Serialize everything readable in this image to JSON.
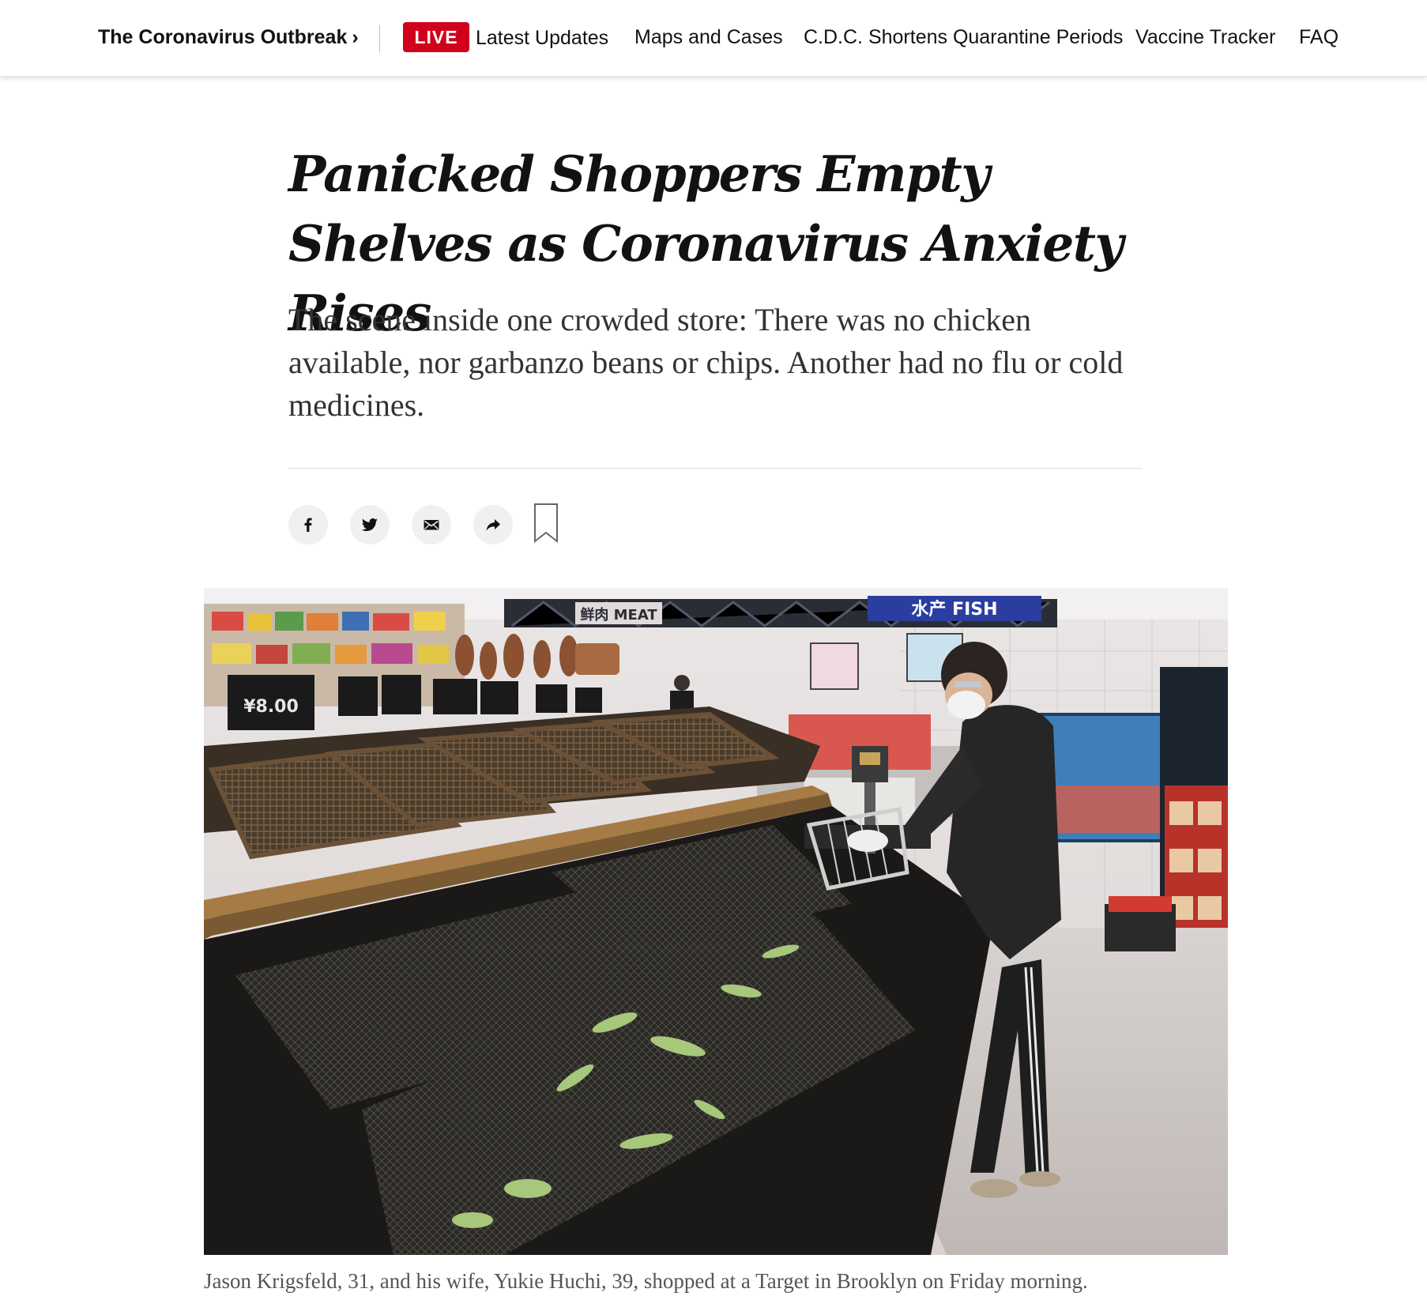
{
  "nav": {
    "home_label": "The Coronavirus Outbreak",
    "home_chevron": "›",
    "live_badge": "LIVE",
    "live_label": "Latest Updates",
    "items": [
      "Maps and Cases",
      "C.D.C. Shortens Quarantine Periods",
      "Vaccine Tracker",
      "FAQ"
    ]
  },
  "article": {
    "headline": "Panicked Shoppers Empty Shelves as Coronavirus Anxiety Rises",
    "summary": "The scene inside one crowded store: There was no chicken available, nor garbanzo beans or chips. Another had no flu or cold medicines.",
    "caption": "Jason Krigsfeld, 31, and his wife, Yukie Huchi, 39, shopped at a Target in Brooklyn on Friday morning."
  },
  "photo_signage": {
    "meat_sign": "鲜肉 MEAT",
    "fish_sign": "水产 FISH",
    "price_tag": "¥8.00"
  },
  "share": {
    "icons": [
      "facebook-icon",
      "twitter-icon",
      "email-icon",
      "share-arrow-icon",
      "bookmark-icon"
    ]
  },
  "colors": {
    "live_red": "#d0021b",
    "text": "#121212",
    "summary_text": "#333333",
    "caption_text": "#555555",
    "share_button_bg": "#f0f0f0"
  }
}
